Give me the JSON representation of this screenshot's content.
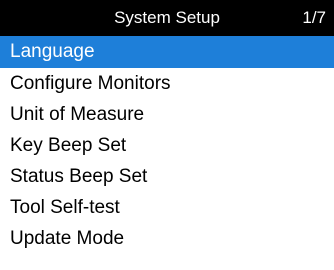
{
  "header": {
    "title": "System Setup",
    "page_indicator": "1/7"
  },
  "menu": {
    "items": [
      {
        "label": "Language",
        "selected": true
      },
      {
        "label": "Configure Monitors",
        "selected": false
      },
      {
        "label": "Unit of Measure",
        "selected": false
      },
      {
        "label": "Key Beep Set",
        "selected": false
      },
      {
        "label": "Status Beep Set",
        "selected": false
      },
      {
        "label": "Tool Self-test",
        "selected": false
      },
      {
        "label": "Update Mode",
        "selected": false
      }
    ]
  },
  "colors": {
    "title_bar": "#000000",
    "selection": "#1e7fd9",
    "background": "#ffffff"
  }
}
